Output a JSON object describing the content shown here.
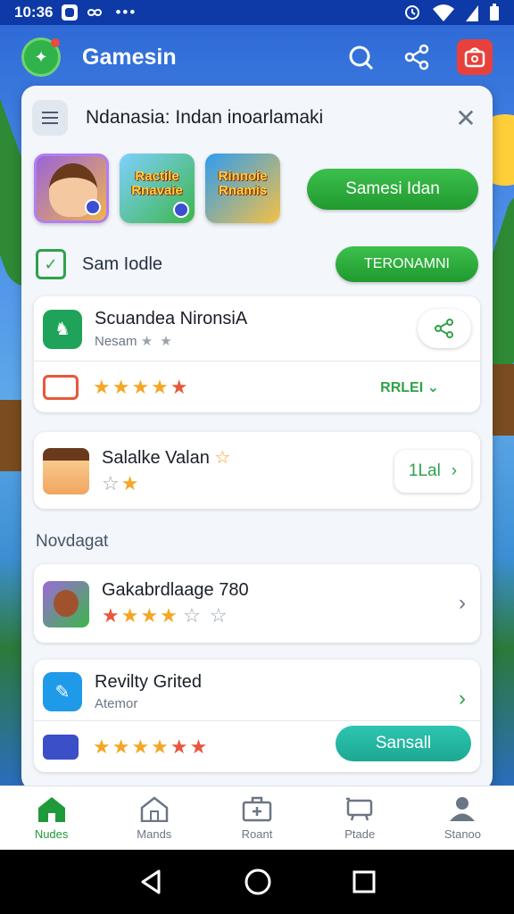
{
  "status_bar": {
    "time": "10:36",
    "dots": "•••"
  },
  "app_bar": {
    "logo_glyph": "✦",
    "title": "Gamesin"
  },
  "card": {
    "title": "Ndanasia: Indan inoarlamaki",
    "tiles": [
      {
        "text": ""
      },
      {
        "text": "Ractile Rnavaie"
      },
      {
        "text": "Rinnoie Rnamis"
      }
    ],
    "main_button": "Samesi Idan",
    "section": {
      "label": "Sam Iodle",
      "button": "TERONAMNI"
    },
    "items": [
      {
        "title": "Scuandea NironsiA",
        "subtitle": "Nesam",
        "subtitle_stars": "★ ★",
        "stars": "★★★★",
        "star_red": "★",
        "rate_link": "RRLEI ⌄"
      },
      {
        "title": "Salalke Valan",
        "title_star": "☆",
        "stars_empty": "☆",
        "stars": "★",
        "button": "1Lal"
      }
    ],
    "group_label": "Novdagat",
    "items2": [
      {
        "title": "Gakabrdlaage 780",
        "stars_red": "★",
        "stars": "★★★",
        "stars_empty": "☆ ☆"
      },
      {
        "title": "Revilty Grited",
        "subtitle": "Atemor",
        "stars": "★★★★",
        "stars_red": "★★",
        "button": "Sansall"
      }
    ]
  },
  "bottom_nav": [
    {
      "label": "Nudes",
      "icon": "home-icon"
    },
    {
      "label": "Mands",
      "icon": "house-icon"
    },
    {
      "label": "Roant",
      "icon": "briefcase-icon"
    },
    {
      "label": "Ptade",
      "icon": "cart-icon"
    },
    {
      "label": "Stanoo",
      "icon": "person-icon"
    }
  ],
  "colors": {
    "primary": "#21992f",
    "appbar": "#1d4fb8",
    "teal": "#1ca892",
    "star": "#f5a623"
  }
}
